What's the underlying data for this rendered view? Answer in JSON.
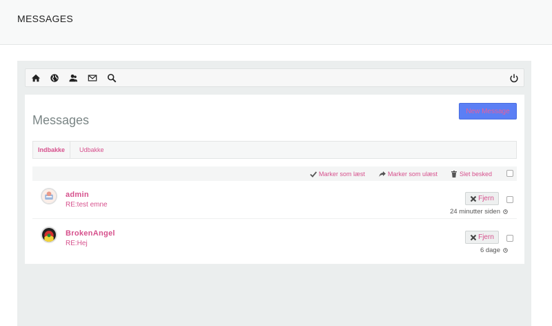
{
  "page": {
    "title": "MESSAGES"
  },
  "toolbar": {
    "icons": [
      "home-icon",
      "globe-icon",
      "users-icon",
      "envelope-icon",
      "search-icon"
    ],
    "right_icon": "power-icon"
  },
  "panel": {
    "title": "Messages",
    "new_message_label": "New Message"
  },
  "tabs": [
    {
      "label": "Indbakke",
      "active": true
    },
    {
      "label": "Udbakke",
      "active": false
    }
  ],
  "actions": {
    "mark_read": "Marker som læst",
    "mark_unread": "Marker som ulæst",
    "delete": "Slet besked"
  },
  "messages": [
    {
      "sender": "admin",
      "subject": "RE:test emne",
      "remove_label": "Fjern",
      "time": "24 minutter siden"
    },
    {
      "sender": "BrokenAngel",
      "subject": "RE:Hej",
      "remove_label": "Fjern",
      "time": "6 dage"
    }
  ],
  "colors": {
    "accent": "#d6508c",
    "button": "#5b7ff5",
    "background": "#ebeeee"
  }
}
